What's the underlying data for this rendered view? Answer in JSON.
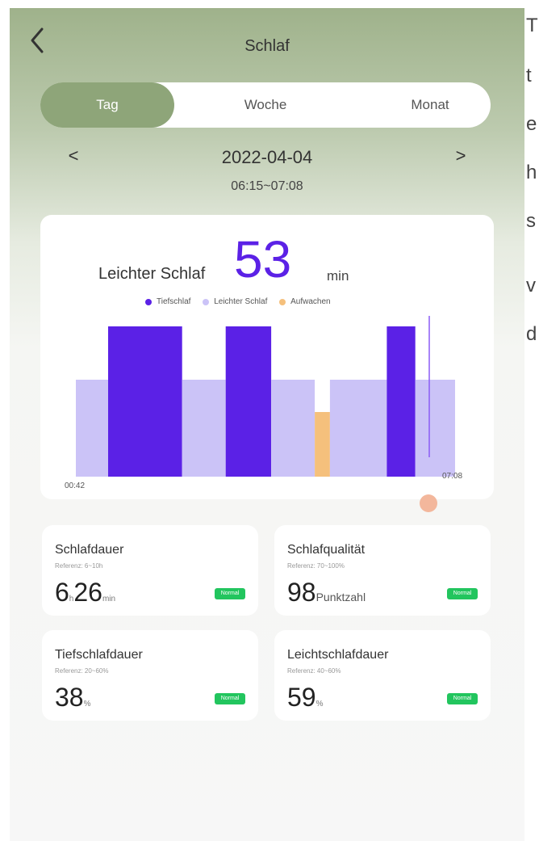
{
  "header": {
    "title": "Schlaf"
  },
  "tabs": [
    {
      "label": "Tag",
      "active": true
    },
    {
      "label": "Woche",
      "active": false
    },
    {
      "label": "Monat",
      "active": false
    }
  ],
  "date_nav": {
    "prev": "<",
    "date": "2022-04-04",
    "next": ">",
    "time_range": "06:15~07:08"
  },
  "summary": {
    "label": "Leichter Schlaf",
    "value": "53",
    "unit": "min"
  },
  "legend": [
    {
      "label": "Tiefschlaf",
      "color": "#5b21e6"
    },
    {
      "label": "Leichter Schlaf",
      "color": "#cbc3f7"
    },
    {
      "label": "Aufwachen",
      "color": "#f5c07c"
    }
  ],
  "chart_data": {
    "type": "bar",
    "x_start": "00:42",
    "x_end": "07:08",
    "levels": [
      "Leichter Schlaf",
      "Tiefschlaf",
      "Aufwachen"
    ],
    "segments": [
      {
        "stage": "Leichter Schlaf",
        "from": 0.0,
        "to": 0.085
      },
      {
        "stage": "Tiefschlaf",
        "from": 0.085,
        "to": 0.28
      },
      {
        "stage": "Leichter Schlaf",
        "from": 0.28,
        "to": 0.395
      },
      {
        "stage": "Tiefschlaf",
        "from": 0.395,
        "to": 0.515
      },
      {
        "stage": "Leichter Schlaf",
        "from": 0.515,
        "to": 0.63
      },
      {
        "stage": "Aufwachen",
        "from": 0.63,
        "to": 0.67
      },
      {
        "stage": "Leichter Schlaf",
        "from": 0.67,
        "to": 0.82
      },
      {
        "stage": "Tiefschlaf",
        "from": 0.82,
        "to": 0.895
      },
      {
        "stage": "Leichter Schlaf",
        "from": 0.895,
        "to": 1.0
      }
    ]
  },
  "stats": [
    {
      "title": "Schlafdauer",
      "ref": "Referenz: 6~10h",
      "value": "6",
      "unit": "h",
      "value2": "26",
      "unit2": "min",
      "badge": "Normal"
    },
    {
      "title": "Schlafqualität",
      "ref": "Referenz: 70~100%",
      "value": "98",
      "unit": "Punktzahl",
      "badge": "Normal"
    },
    {
      "title": "Tiefschlafdauer",
      "ref": "Referenz: 20~60%",
      "value": "38",
      "unit": "%",
      "badge": "Normal"
    },
    {
      "title": "Leichtschlafdauer",
      "ref": "Referenz: 40~60%",
      "value": "59",
      "unit": "%",
      "badge": "Normal"
    }
  ],
  "side_text": [
    "T",
    "t",
    "e",
    "h",
    "s",
    "v",
    "d"
  ],
  "colors": {
    "accent": "#5b21e6",
    "tab_active": "#8ea579",
    "badge": "#22c55e",
    "scrub": "#f3b79c"
  }
}
